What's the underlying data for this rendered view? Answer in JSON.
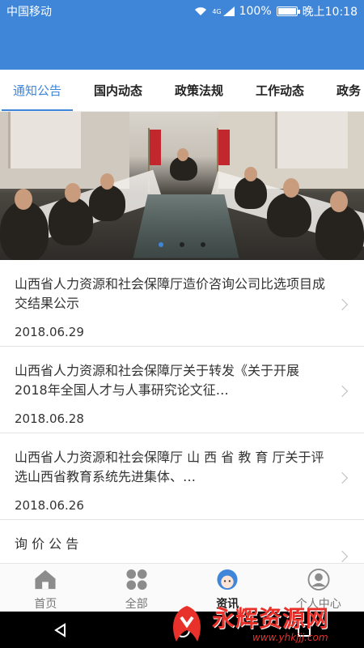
{
  "status_bar": {
    "carrier": "中国移动",
    "network": "4G",
    "battery": "100%",
    "time": "晚上10:18"
  },
  "tabs": [
    {
      "label": "通知公告",
      "active": true
    },
    {
      "label": "国内动态",
      "active": false
    },
    {
      "label": "政策法规",
      "active": false
    },
    {
      "label": "工作动态",
      "active": false
    },
    {
      "label": "政务",
      "active": false
    }
  ],
  "banner": {
    "indicator_active_index": 0,
    "indicator_count": 3
  },
  "news": [
    {
      "title": "山西省人力资源和社会保障厅造价咨询公司比选项目成交结果公示",
      "date": "2018.06.29"
    },
    {
      "title": "山西省人力资源和社会保障厅关于转发《关于开展2018年全国人才与人事研究论文征…",
      "date": "2018.06.28"
    },
    {
      "title": "山西省人力资源和社会保障厅 山 西 省 教 育 厅关于评选山西省教育系统先进集体、…",
      "date": "2018.06.26"
    },
    {
      "title": "询 价 公 告",
      "date": ""
    }
  ],
  "bottom_nav": [
    {
      "label": "首页",
      "icon": "home-icon",
      "active": false
    },
    {
      "label": "全部",
      "icon": "grid-icon",
      "active": false
    },
    {
      "label": "资讯",
      "icon": "news-face-icon",
      "active": true
    },
    {
      "label": "个人中心",
      "icon": "user-icon",
      "active": false
    }
  ],
  "watermark": {
    "title": "永辉资源网",
    "url": "www.yhkjjj.com"
  },
  "colors": {
    "primary": "#3f86d9",
    "text": "#333333",
    "watermark": "#e8312b"
  }
}
